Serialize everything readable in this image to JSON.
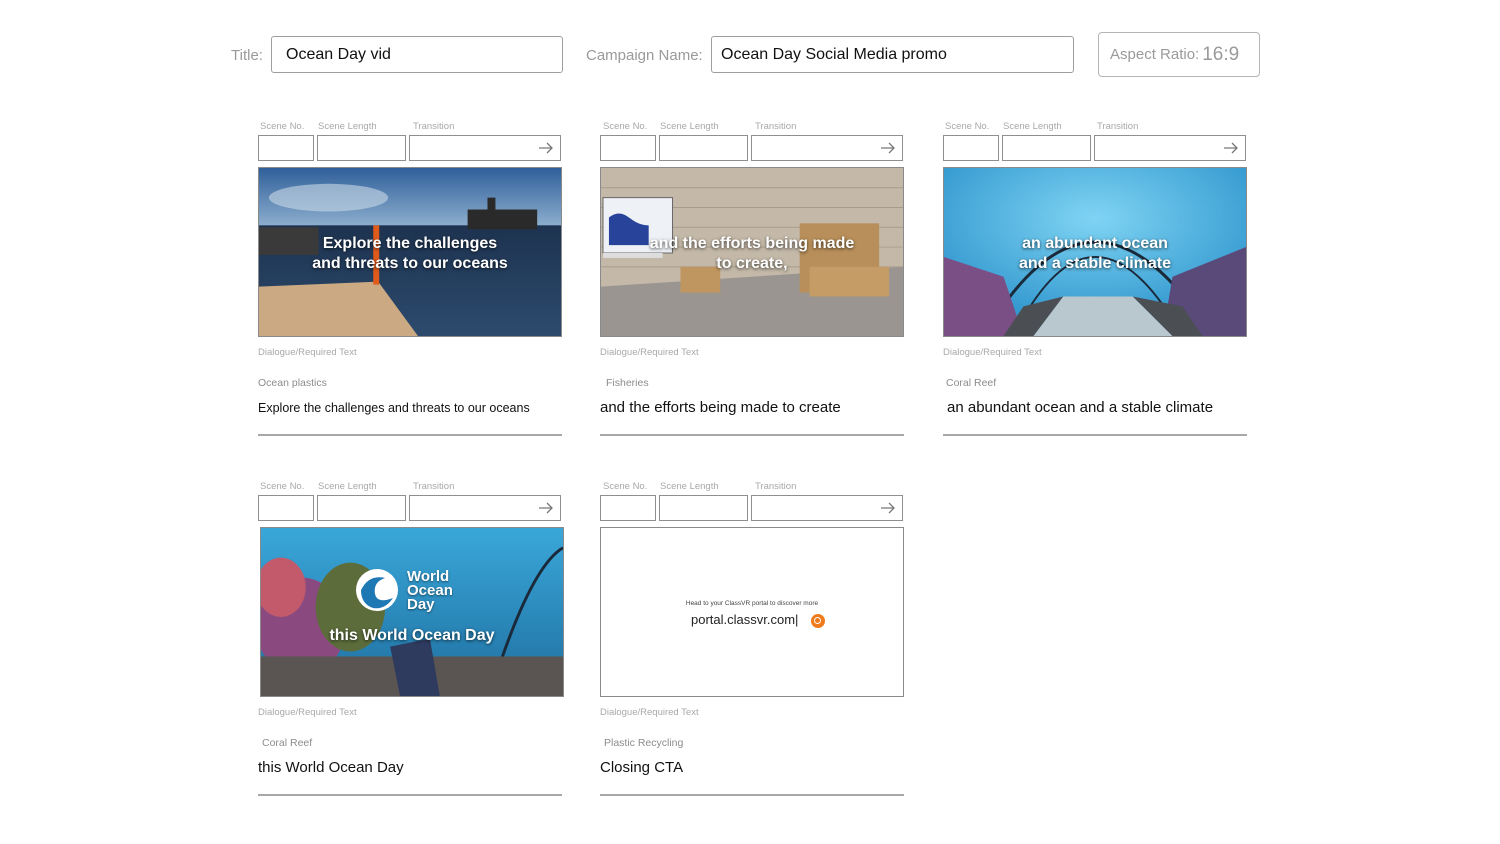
{
  "header": {
    "title_label": "Title:",
    "title_value": "Ocean Day vid",
    "campaign_label": "Campaign Name:",
    "campaign_value": "Ocean Day Social Media promo",
    "aspect_label": "Aspect Ratio:",
    "aspect_value": "16:9"
  },
  "field_labels": {
    "scene_no": "Scene No.",
    "scene_length": "Scene Length",
    "transition": "Transition",
    "dialogue": "Dialogue/Required Text"
  },
  "scenes": [
    {
      "overlay_line1": "Explore the challenges",
      "overlay_line2": "and threats to our oceans",
      "topic": "Ocean plastics",
      "dialogue": "Explore the challenges and threats to our oceans"
    },
    {
      "overlay_line1": "and the efforts being made",
      "overlay_line2": "to create,",
      "topic": "Fisheries",
      "dialogue": "and the efforts being made to create"
    },
    {
      "overlay_line1": "an abundant ocean",
      "overlay_line2": "and a stable climate",
      "topic": "Coral Reef",
      "dialogue": "an abundant ocean and a stable climate"
    },
    {
      "overlay_line1": "this World Ocean Day",
      "logo_line1": "World",
      "logo_line2": "Ocean",
      "logo_line3": "Day",
      "topic": "Coral Reef",
      "dialogue": "this World Ocean Day"
    },
    {
      "cta_small": "Head to your ClassVR portal to discover more",
      "cta_url": "portal.classvr.com|",
      "topic": "Plastic Recycling",
      "dialogue": "Closing CTA"
    }
  ]
}
